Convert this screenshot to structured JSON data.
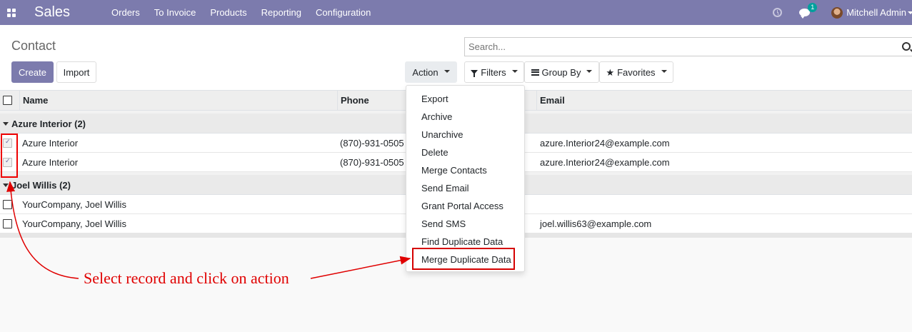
{
  "navbar": {
    "app_title": "Sales",
    "menu": [
      "Orders",
      "To Invoice",
      "Products",
      "Reporting",
      "Configuration"
    ],
    "chat_badge": "1",
    "user_name": "Mitchell Admin",
    "bg_color": "#7c7bad"
  },
  "control_panel": {
    "breadcrumb": "Contact",
    "create_label": "Create",
    "import_label": "Import",
    "action_label": "Action",
    "search_placeholder": "Search...",
    "filters_label": "Filters",
    "groupby_label": "Group By",
    "favorites_label": "Favorites"
  },
  "table": {
    "headers": {
      "name": "Name",
      "phone": "Phone",
      "email": "Email"
    },
    "groups": [
      {
        "label": "Azure Interior (2)",
        "rows": [
          {
            "name": "Azure Interior",
            "phone": "(870)-931-0505",
            "email": "azure.Interior24@example.com",
            "checked": true
          },
          {
            "name": "Azure Interior",
            "phone": "(870)-931-0505",
            "email": "azure.Interior24@example.com",
            "checked": true
          }
        ]
      },
      {
        "label": "Joel Willis (2)",
        "rows": [
          {
            "name": "YourCompany, Joel Willis",
            "phone": "",
            "email": "",
            "checked": false
          },
          {
            "name": "YourCompany, Joel Willis",
            "phone": "",
            "email": "joel.willis63@example.com",
            "checked": false
          }
        ]
      }
    ]
  },
  "action_menu": {
    "items": [
      "Export",
      "Archive",
      "Unarchive",
      "Delete",
      "Merge Contacts",
      "Send Email",
      "Grant Portal Access",
      "Send SMS",
      "Find Duplicate Data",
      "Merge Duplicate Data"
    ],
    "highlighted_item": "Merge Duplicate Data"
  },
  "annotation": {
    "text": "Select record and click on action",
    "color": "#e00000"
  }
}
